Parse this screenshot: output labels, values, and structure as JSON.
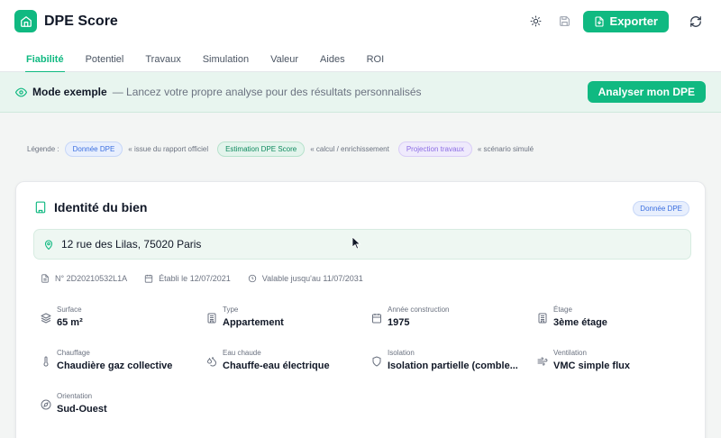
{
  "app": {
    "title": "DPE Score",
    "export_label": "Exporter"
  },
  "tabs": [
    {
      "label": "Fiabilité",
      "active": true
    },
    {
      "label": "Potentiel"
    },
    {
      "label": "Travaux"
    },
    {
      "label": "Simulation"
    },
    {
      "label": "Valeur"
    },
    {
      "label": "Aides"
    },
    {
      "label": "ROI"
    }
  ],
  "banner": {
    "title": "Mode exemple",
    "text": "— Lancez votre propre analyse pour des résultats personnalisés",
    "button": "Analyser mon DPE"
  },
  "legend": {
    "prefix": "Légende :",
    "items": [
      {
        "pill": "Donnée DPE",
        "text": "« issue du rapport officiel"
      },
      {
        "pill": "Estimation DPE Score",
        "text": "« calcul / enrichissement"
      },
      {
        "pill": "Projection travaux",
        "text": "« scénario simulé"
      }
    ]
  },
  "card": {
    "title": "Identité du bien",
    "badge": "Donnée DPE",
    "address": "12 rue des Lilas, 75020 Paris",
    "meta": {
      "number": "N° 2D20210532L1A",
      "issued": "Établi le 12/07/2021",
      "valid": "Valable jusqu'au 11/07/2031"
    },
    "fields": [
      {
        "label": "Surface",
        "value": "65 m²",
        "icon": "layers-icon"
      },
      {
        "label": "Type",
        "value": "Appartement",
        "icon": "building-icon"
      },
      {
        "label": "Année construction",
        "value": "1975",
        "icon": "calendar-icon"
      },
      {
        "label": "Étage",
        "value": "3ème étage",
        "icon": "building-icon"
      },
      {
        "label": "Chauffage",
        "value": "Chaudière gaz collective",
        "icon": "thermometer-icon"
      },
      {
        "label": "Eau chaude",
        "value": "Chauffe-eau électrique",
        "icon": "droplets-icon"
      },
      {
        "label": "Isolation",
        "value": "Isolation partielle (comble...",
        "icon": "shield-icon"
      },
      {
        "label": "Ventilation",
        "value": "VMC simple flux",
        "icon": "wind-icon"
      },
      {
        "label": "Orientation",
        "value": "Sud-Ouest",
        "icon": "compass-icon"
      }
    ]
  },
  "colors": {
    "accent": "#10b981",
    "banner_bg": "#e8f5ef"
  }
}
